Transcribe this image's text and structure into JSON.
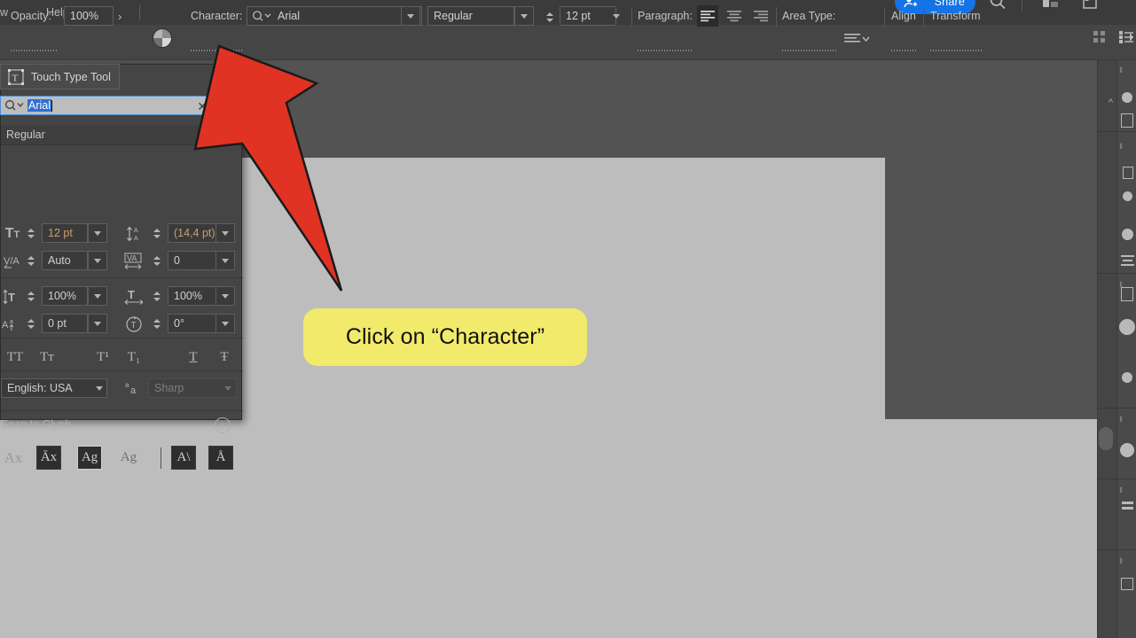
{
  "app": {
    "menubar": {
      "items": [
        {
          "label": "w",
          "x": 0
        },
        {
          "label": "Help",
          "x": 52
        }
      ]
    },
    "share_button": {
      "label": "Share",
      "icon": "share-person-icon",
      "color": "#1473e6"
    },
    "header_icons": [
      {
        "name": "search-icon"
      },
      {
        "name": "workspace-layout-icon"
      },
      {
        "name": "panel-toggle-icon"
      }
    ]
  },
  "options_bar": {
    "opacity_label": "Opacity:",
    "opacity_value": "100%",
    "opacity_more": "›",
    "character_label": "Character:",
    "font_family": "Arial",
    "font_style": "Regular",
    "font_size": "12 pt",
    "paragraph_label": "Paragraph:",
    "area_type_label": "Area Type:",
    "align_label": "Align",
    "transform_label": "Transform"
  },
  "tooltip_chip": {
    "label": "Touch Type Tool",
    "icon": "touch-type-tool-icon"
  },
  "character_panel": {
    "search": {
      "value": "Arial",
      "selected": true,
      "icon": "search-filter-icon",
      "clear_icon": "close-icon"
    },
    "style_value": "Regular",
    "fields": [
      {
        "icon": "font-size-icon",
        "name": "font-size",
        "value": "12 pt"
      },
      {
        "icon": "leading-icon",
        "name": "leading",
        "value": "(14,4 pt)"
      },
      {
        "icon": "kerning-icon",
        "name": "kerning",
        "value": "Auto"
      },
      {
        "icon": "tracking-icon",
        "name": "tracking",
        "value": "0"
      },
      {
        "icon": "vertical-scale-icon",
        "name": "vertical-scale",
        "value": "100%"
      },
      {
        "icon": "horizontal-scale-icon",
        "name": "horizontal-scale",
        "value": "100%"
      },
      {
        "icon": "baseline-shift-icon",
        "name": "baseline-shift",
        "value": "0 pt"
      },
      {
        "icon": "character-rotation-icon",
        "name": "character-rotation",
        "value": "0°"
      }
    ],
    "type_buttons": [
      {
        "name": "all-caps-button",
        "glyph": "TT"
      },
      {
        "name": "small-caps-button",
        "glyph": "Tт"
      },
      {
        "name": "superscript-button",
        "glyph": "T¹"
      },
      {
        "name": "subscript-button",
        "glyph": "T₁"
      },
      {
        "name": "underline-button",
        "glyph": "T"
      },
      {
        "name": "strikethrough-button",
        "glyph": "Ŧ"
      }
    ],
    "language": "English: USA",
    "anti_alias": "Sharp",
    "anti_alias_icon": "anti-alias-icon",
    "snap_to_glyph_label": "Snap to Glyph",
    "info_icon": "info-icon",
    "glyph_buttons": [
      {
        "name": "snap-baseline-button",
        "glyph": "Ax"
      },
      {
        "name": "snap-cap-height-button",
        "glyph": "Āx"
      },
      {
        "name": "snap-em-box-button",
        "glyph": "Ag",
        "selected": true
      },
      {
        "name": "snap-x-height-button",
        "glyph": "Ag",
        "disabled": true
      },
      {
        "name": "snap-stem-button",
        "glyph": "A\\"
      },
      {
        "name": "snap-center-button",
        "glyph": "Å"
      }
    ]
  },
  "callout": {
    "text": "Click on “Character”",
    "background": "#f2ea6a",
    "text_color": "#111111"
  },
  "arrow": {
    "name": "red-pointer-arrow",
    "color": "#e03323",
    "stroke": "#1a1a1a"
  },
  "canvas": {
    "page_color": "#bdbdbd",
    "backdrop_color": "#535353"
  }
}
